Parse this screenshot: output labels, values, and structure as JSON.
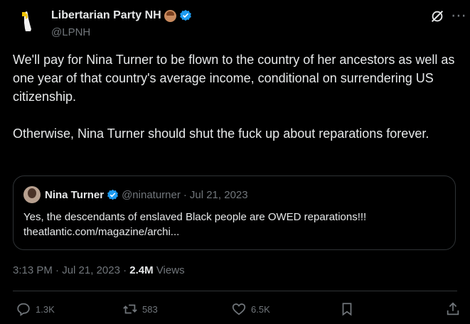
{
  "post": {
    "author_name": "Libertarian Party NH",
    "author_handle": "@LPNH",
    "text": "We'll pay for Nina Turner to be flown to the country of her ancestors as well as one year of that country's average income, conditional on surrendering US citizenship.\n\nOtherwise, Nina Turner should shut the fuck up about reparations forever.",
    "time": "3:13 PM",
    "separator": "·",
    "date": "Jul 21, 2023",
    "views_count": "2.4M",
    "views_label": "Views"
  },
  "quote": {
    "author_name": "Nina Turner",
    "author_handle": "@ninaturner",
    "separator": "·",
    "date": "Jul 21, 2023",
    "text": "Yes, the descendants of enslaved Black people are OWED reparations!!!\ntheatlantic.com/magazine/archi..."
  },
  "actions": {
    "replies": "1.3K",
    "reposts": "583",
    "likes": "6.5K"
  },
  "colors": {
    "background": "#000000",
    "text": "#e7e9ea",
    "secondary": "#71767b",
    "verified": "#1d9bf0",
    "border": "#2f3336"
  }
}
